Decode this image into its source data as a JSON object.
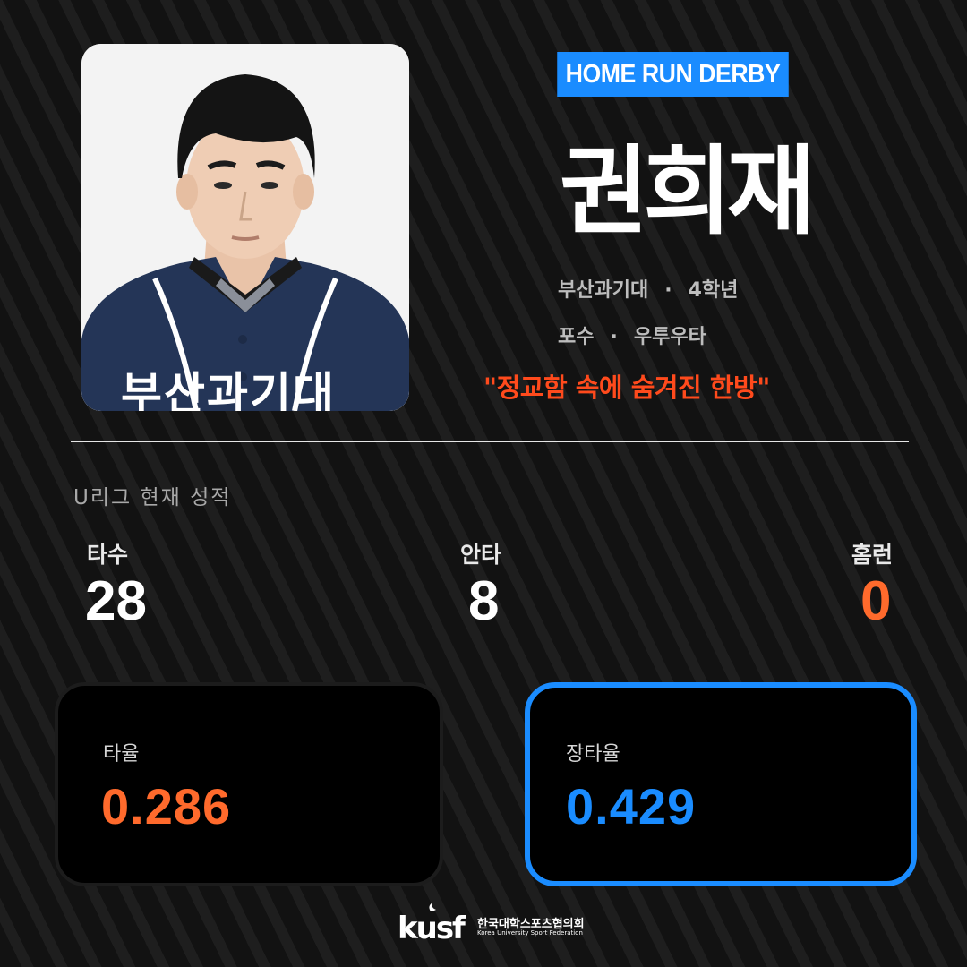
{
  "badge": "HOME RUN DERBY",
  "player": {
    "name": "권희재",
    "school": "부산과기대",
    "grade": "4학년",
    "position": "포수",
    "bats_throws": "우투우타",
    "separator": "·",
    "jersey_text": "부산과기대",
    "slogan": "\"정교함 속에 숨겨진 한방\""
  },
  "section_title": "U리그 현재 성적",
  "stats": [
    {
      "label": "타수",
      "value": "28"
    },
    {
      "label": "안타",
      "value": "8"
    },
    {
      "label": "홈런",
      "value": "0"
    }
  ],
  "cards": [
    {
      "label": "타율",
      "value": "0.286"
    },
    {
      "label": "장타율",
      "value": "0.429"
    }
  ],
  "logo": {
    "mark": "kusf",
    "name_ko": "한국대학스포츠협의회",
    "name_en": "Korea University Sport Federation"
  },
  "colors": {
    "accent_blue": "#1a8cff",
    "accent_orange": "#ff6a2c",
    "slogan_red": "#ff4a1c",
    "background": "#121212"
  }
}
